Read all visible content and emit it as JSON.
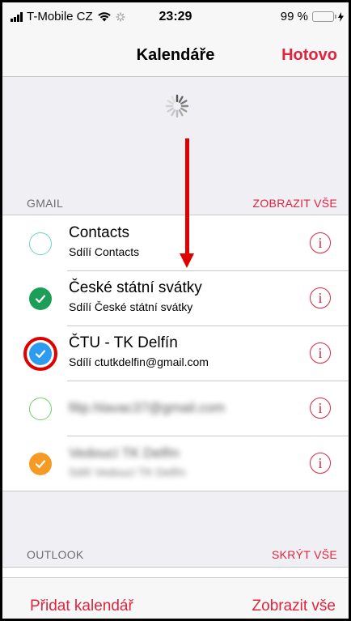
{
  "status_bar": {
    "carrier": "T-Mobile CZ",
    "time": "23:29",
    "battery": "99 %",
    "battery_level": 0.99
  },
  "nav": {
    "title": "Kalendáře",
    "done_label": "Hotovo"
  },
  "sections": [
    {
      "header": "GMAIL",
      "action": "ZOBRAZIT VŠE",
      "items": [
        {
          "name": "Contacts",
          "subtitle": "Sdílí Contacts",
          "checked": false,
          "color": "#6cd3c4"
        },
        {
          "name": "České státní svátky",
          "subtitle": "Sdílí České státní svátky",
          "checked": true,
          "color": "#1c9e57"
        },
        {
          "name": "ČTU - TK Delfín",
          "subtitle": "Sdílí ctutkdelfin@gmail.com",
          "checked": true,
          "color": "#2d9bf0"
        },
        {
          "name": "filip.hlavac37@gmail.com",
          "subtitle": "",
          "checked": false,
          "color": "#6fd067"
        },
        {
          "name": "Vedoucí TK Delfín",
          "subtitle": "Sdílí Vedoucí TK Delfín",
          "checked": true,
          "color": "#f59b25"
        }
      ]
    },
    {
      "header": "OUTLOOK",
      "action": "SKRÝT VŠE"
    }
  ],
  "toolbar": {
    "add_label": "Přidat kalendář",
    "show_all_label": "Zobrazit vše"
  },
  "colors": {
    "accent": "#e0243e",
    "annotation": "#e00000"
  }
}
